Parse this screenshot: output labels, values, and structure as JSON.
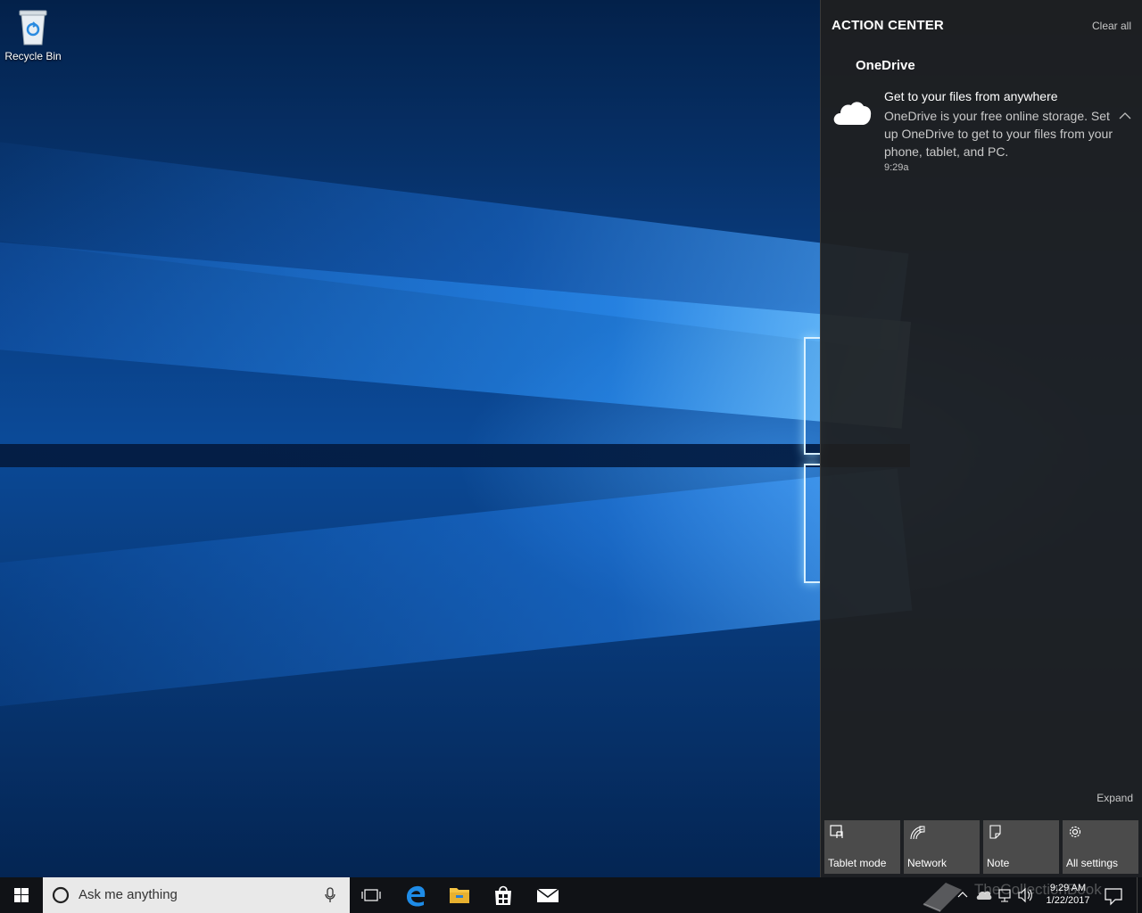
{
  "desktop": {
    "icons": [
      {
        "label": "Recycle Bin",
        "icon": "recycle-bin-icon"
      }
    ]
  },
  "action_center": {
    "title": "ACTION CENTER",
    "clear_all": "Clear all",
    "app_group": "OneDrive",
    "notification": {
      "icon": "onedrive-cloud-icon",
      "title": "Get to your files from anywhere",
      "body": "OneDrive is your free online storage. Set up OneDrive to get to your files from your phone, tablet, and PC.",
      "time": "9:29a"
    },
    "expand": "Expand",
    "quick_actions": [
      {
        "label": "Tablet mode",
        "icon": "tablet-mode-icon"
      },
      {
        "label": "Network",
        "icon": "network-icon"
      },
      {
        "label": "Note",
        "icon": "note-icon"
      },
      {
        "label": "All settings",
        "icon": "gear-icon"
      }
    ]
  },
  "taskbar": {
    "search_placeholder": "Ask me anything",
    "pinned": [
      "task-view-icon",
      "edge-icon",
      "file-explorer-icon",
      "store-icon",
      "mail-icon"
    ],
    "clock_time": "9:29 AM",
    "clock_date": "1/22/2017",
    "watermark": "TheCollectionBook"
  },
  "colors": {
    "action_center_bg": "#1f1f1f",
    "tile_bg": "#4b4b4b",
    "taskbar_bg": "#101216",
    "accent": "#0078d7"
  }
}
